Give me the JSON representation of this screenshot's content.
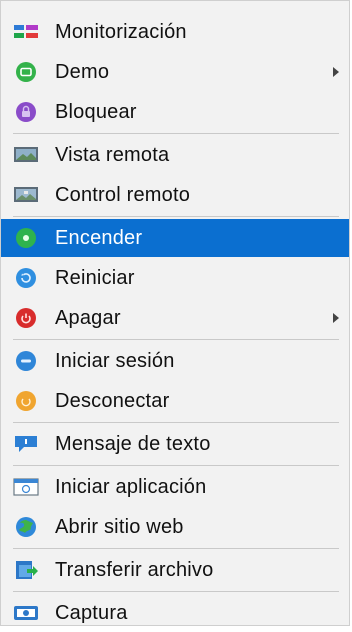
{
  "menu": {
    "items": [
      {
        "id": "monitor",
        "label": "Monitorización",
        "icon": "monitoring-bars-icon",
        "submenu": false,
        "active": false
      },
      {
        "id": "demo",
        "label": "Demo",
        "icon": "demo-green-circle-icon",
        "submenu": true,
        "active": false
      },
      {
        "id": "lock",
        "label": "Bloquear",
        "icon": "lock-purple-circle-icon",
        "submenu": false,
        "active": false
      },
      {
        "id": "view",
        "label": "Vista remota",
        "icon": "remote-view-monitor-icon",
        "submenu": false,
        "active": false
      },
      {
        "id": "control",
        "label": "Control remoto",
        "icon": "remote-control-monitor-icon",
        "submenu": false,
        "active": false
      },
      {
        "id": "power-on",
        "label": "Encender",
        "icon": "power-on-green-circle-icon",
        "submenu": false,
        "active": true
      },
      {
        "id": "restart",
        "label": "Reiniciar",
        "icon": "restart-blue-circle-icon",
        "submenu": false,
        "active": false
      },
      {
        "id": "shutdown",
        "label": "Apagar",
        "icon": "shutdown-red-circle-icon",
        "submenu": true,
        "active": false
      },
      {
        "id": "login",
        "label": "Iniciar sesión",
        "icon": "login-blue-circle-icon",
        "submenu": false,
        "active": false
      },
      {
        "id": "logout",
        "label": "Desconectar",
        "icon": "logout-orange-circle-icon",
        "submenu": false,
        "active": false
      },
      {
        "id": "message",
        "label": "Mensaje de texto",
        "icon": "message-speech-bubble-icon",
        "submenu": false,
        "active": false
      },
      {
        "id": "start-app",
        "label": "Iniciar aplicación",
        "icon": "start-application-window-icon",
        "submenu": false,
        "active": false
      },
      {
        "id": "open-web",
        "label": "Abrir sitio web",
        "icon": "globe-icon",
        "submenu": false,
        "active": false
      },
      {
        "id": "transfer",
        "label": "Transferir archivo",
        "icon": "transfer-file-icon",
        "submenu": false,
        "active": false
      },
      {
        "id": "capture",
        "label": "Captura",
        "icon": "screenshot-camera-icon",
        "submenu": false,
        "active": false
      }
    ]
  },
  "colors": {
    "selection_blue": "#0b6fd0",
    "menu_bg": "#f2f2f2",
    "divider": "#c9c9c9"
  }
}
